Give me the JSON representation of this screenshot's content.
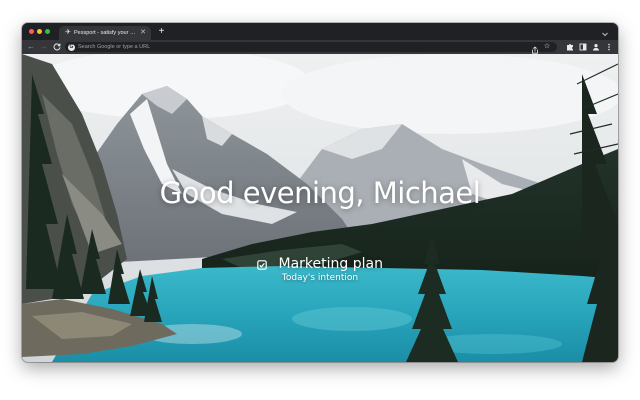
{
  "browser": {
    "tab": {
      "title": "Pessport - satisfy your nande",
      "favicon": "passport-icon"
    },
    "new_tab_label": "+",
    "omnibox": {
      "placeholder": "Search Google or type a URL"
    },
    "traffic_light_colors": {
      "close": "#ff5f57",
      "minimize": "#febc2e",
      "maximize": "#28c840"
    }
  },
  "page": {
    "greeting": "Good evening, Michael",
    "focus": {
      "title": "Marketing plan",
      "subtitle": "Today's intention"
    }
  },
  "colors": {
    "chrome_dark": "#202124",
    "chrome_toolbar": "#35363a",
    "lake": "#2aa7bd",
    "forest": "#1c2b22"
  }
}
